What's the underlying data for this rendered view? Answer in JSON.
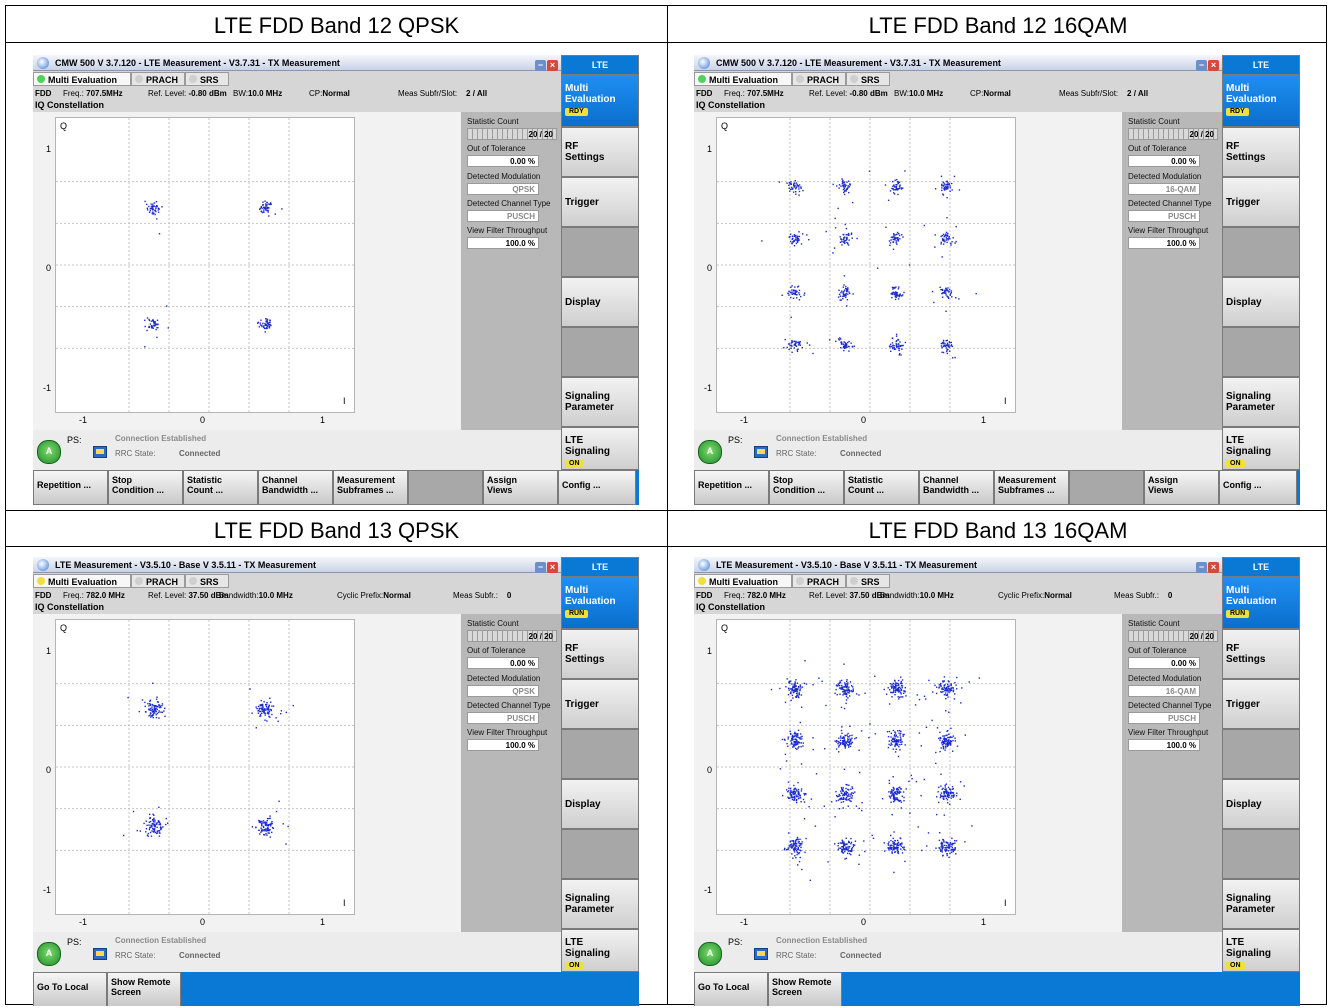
{
  "captions": [
    "LTE FDD Band 12 QPSK",
    "LTE FDD Band 12 16QAM",
    "LTE FDD Band 13 QPSK",
    "LTE FDD Band 13 16QAM"
  ],
  "panels": [
    {
      "title": "CMW 500 V 3.7.120 - LTE Measurement  - V3.7.31 - TX Measurement",
      "tabs": [
        "Multi Evaluation",
        "PRACH",
        "SRS"
      ],
      "led": "green",
      "info": {
        "mode": "FDD",
        "freq_label": "Freq.:",
        "freq": "707.5MHz",
        "ref_label": "Ref. Level:",
        "ref": "-0.80 dBm",
        "bw_label": "BW:",
        "bw": "10.0 MHz",
        "cp_label": "CP:",
        "cp": "Normal",
        "subfr_label": "Meas Subfr/Slot:",
        "subfr": "2  / All"
      },
      "plot_title": "IQ Constellation",
      "axis": {
        "q": "Q",
        "i": "I",
        "y_ticks": [
          "1",
          "0",
          "-1"
        ],
        "x_ticks": [
          "-1",
          "0",
          "1"
        ]
      },
      "stats": {
        "count_label": "Statistic Count",
        "count": "20 / 20",
        "tol_label": "Out of Tolerance",
        "tol": "0.00  %",
        "mod_label": "Detected Modulation",
        "mod": "QPSK",
        "chan_label": "Detected Channel Type",
        "chan": "PUSCH",
        "thr_label": "View Filter Throughput",
        "thr": "100.0  %"
      },
      "status": {
        "ps": "PS:",
        "conn": "Connection Established",
        "rrc_label": "RRC State:",
        "rrc": "Connected",
        "antenna": "A"
      },
      "softkeys": [
        "Repetition ...",
        "Stop\nCondition ...",
        "Statistic\nCount ...",
        "Channel\nBandwidth ...",
        "Measurement\nSubframes ...",
        "",
        "Assign\nViews",
        "Config ..."
      ],
      "sidebar": {
        "top": "LTE",
        "multi": "Multi\nEvaluation",
        "multi_badge": "RDY",
        "rf": "RF\nSettings",
        "trigger": "Trigger",
        "display": "Display",
        "signaling_param": "Signaling\nParameter",
        "lte_sig": "LTE\nSignaling",
        "lte_sig_badge": "ON"
      },
      "constellation": {
        "modulation": "QPSK",
        "points": [
          [
            -0.7,
            0.7
          ],
          [
            0.7,
            0.7
          ],
          [
            -0.7,
            -0.7
          ],
          [
            0.7,
            -0.7
          ]
        ]
      }
    },
    {
      "title": "CMW 500 V 3.7.120 - LTE Measurement  - V3.7.31 - TX Measurement",
      "tabs": [
        "Multi Evaluation",
        "PRACH",
        "SRS"
      ],
      "led": "green",
      "info": {
        "mode": "FDD",
        "freq_label": "Freq.:",
        "freq": "707.5MHz",
        "ref_label": "Ref. Level:",
        "ref": "-0.80 dBm",
        "bw_label": "BW:",
        "bw": "10.0 MHz",
        "cp_label": "CP:",
        "cp": "Normal",
        "subfr_label": "Meas Subfr/Slot:",
        "subfr": "2  / All"
      },
      "plot_title": "IQ Constellation",
      "axis": {
        "q": "Q",
        "i": "I",
        "y_ticks": [
          "1",
          "0",
          "-1"
        ],
        "x_ticks": [
          "-1",
          "0",
          "1"
        ]
      },
      "stats": {
        "count_label": "Statistic Count",
        "count": "20 / 20",
        "tol_label": "Out of Tolerance",
        "tol": "0.00  %",
        "mod_label": "Detected Modulation",
        "mod": "16-QAM",
        "chan_label": "Detected Channel Type",
        "chan": "PUSCH",
        "thr_label": "View Filter Throughput",
        "thr": "100.0  %"
      },
      "status": {
        "ps": "PS:",
        "conn": "Connection Established",
        "rrc_label": "RRC State:",
        "rrc": "Connected",
        "antenna": "A"
      },
      "softkeys": [
        "Repetition ...",
        "Stop\nCondition ...",
        "Statistic\nCount ...",
        "Channel\nBandwidth ...",
        "Measurement\nSubframes ...",
        "",
        "Assign\nViews",
        "Config ..."
      ],
      "sidebar": {
        "top": "LTE",
        "multi": "Multi\nEvaluation",
        "multi_badge": "RDY",
        "rf": "RF\nSettings",
        "trigger": "Trigger",
        "display": "Display",
        "signaling_param": "Signaling\nParameter",
        "lte_sig": "LTE\nSignaling",
        "lte_sig_badge": "ON"
      },
      "constellation": {
        "modulation": "16QAM",
        "points": [
          [
            -0.95,
            0.95
          ],
          [
            -0.32,
            0.95
          ],
          [
            0.32,
            0.95
          ],
          [
            0.95,
            0.95
          ],
          [
            -0.95,
            0.32
          ],
          [
            -0.32,
            0.32
          ],
          [
            0.32,
            0.32
          ],
          [
            0.95,
            0.32
          ],
          [
            -0.95,
            -0.32
          ],
          [
            -0.32,
            -0.32
          ],
          [
            0.32,
            -0.32
          ],
          [
            0.95,
            -0.32
          ],
          [
            -0.95,
            -0.95
          ],
          [
            -0.32,
            -0.95
          ],
          [
            0.32,
            -0.95
          ],
          [
            0.95,
            -0.95
          ]
        ]
      }
    },
    {
      "title": "LTE Measurement  - V3.5.10 - Base V 3.5.11 - TX Measurement",
      "tabs": [
        "Multi Evaluation",
        "PRACH",
        "SRS"
      ],
      "led": "yellow",
      "info": {
        "mode": "FDD",
        "freq_label": "Freq.:",
        "freq": "782.0 MHz",
        "ref_label": "Ref. Level:",
        "ref": "37.50 dBm",
        "bw_label": "Bandwidth:",
        "bw": "10.0 MHz",
        "cp_label": "Cyclic Prefix:",
        "cp": "Normal",
        "subfr_label": "Meas Subfr.:",
        "subfr": "0"
      },
      "plot_title": "IQ Constellation",
      "axis": {
        "q": "Q",
        "i": "I",
        "y_ticks": [
          "1",
          "0",
          "-1"
        ],
        "x_ticks": [
          "-1",
          "0",
          "1"
        ]
      },
      "stats": {
        "count_label": "Statistic Count",
        "count": "20 / 20",
        "tol_label": "Out of Tolerance",
        "tol": "0.00  %",
        "mod_label": "Detected Modulation",
        "mod": "QPSK",
        "chan_label": "Detected Channel Type",
        "chan": "PUSCH",
        "thr_label": "View Filter Throughput",
        "thr": "100.0  %"
      },
      "status": {
        "ps": "PS:",
        "conn": "Connection Established",
        "rrc_label": "RRC State:",
        "rrc": "Connected",
        "antenna": "A"
      },
      "softkeys": [
        "Go To Local",
        "Show Remote\nScreen"
      ],
      "sidebar": {
        "top": "LTE",
        "multi": "Multi\nEvaluation",
        "multi_badge": "RUN",
        "rf": "RF\nSettings",
        "trigger": "Trigger",
        "display": "Display",
        "signaling_param": "Signaling\nParameter",
        "lte_sig": "LTE\nSignaling",
        "lte_sig_badge": "ON"
      },
      "constellation": {
        "modulation": "QPSK",
        "points": [
          [
            -0.7,
            0.7
          ],
          [
            0.7,
            0.7
          ],
          [
            -0.7,
            -0.7
          ],
          [
            0.7,
            -0.7
          ]
        ]
      }
    },
    {
      "title": "LTE Measurement  - V3.5.10 - Base V 3.5.11 - TX Measurement",
      "tabs": [
        "Multi Evaluation",
        "PRACH",
        "SRS"
      ],
      "led": "yellow",
      "info": {
        "mode": "FDD",
        "freq_label": "Freq.:",
        "freq": "782.0 MHz",
        "ref_label": "Ref. Level:",
        "ref": "37.50 dBm",
        "bw_label": "Bandwidth:",
        "bw": "10.0 MHz",
        "cp_label": "Cyclic Prefix:",
        "cp": "Normal",
        "subfr_label": "Meas Subfr.:",
        "subfr": "0"
      },
      "plot_title": "IQ Constellation",
      "axis": {
        "q": "Q",
        "i": "I",
        "y_ticks": [
          "1",
          "0",
          "-1"
        ],
        "x_ticks": [
          "-1",
          "0",
          "1"
        ]
      },
      "stats": {
        "count_label": "Statistic Count",
        "count": "20 / 20",
        "tol_label": "Out of Tolerance",
        "tol": "0.00  %",
        "mod_label": "Detected Modulation",
        "mod": "16-QAM",
        "chan_label": "Detected Channel Type",
        "chan": "PUSCH",
        "thr_label": "View Filter Throughput",
        "thr": "100.0  %"
      },
      "status": {
        "ps": "PS:",
        "conn": "Connection Established",
        "rrc_label": "RRC State:",
        "rrc": "Connected",
        "antenna": "A"
      },
      "softkeys": [
        "Go To Local",
        "Show Remote\nScreen"
      ],
      "sidebar": {
        "top": "LTE",
        "multi": "Multi\nEvaluation",
        "multi_badge": "RUN",
        "rf": "RF\nSettings",
        "trigger": "Trigger",
        "display": "Display",
        "signaling_param": "Signaling\nParameter",
        "lte_sig": "LTE\nSignaling",
        "lte_sig_badge": "ON"
      },
      "constellation": {
        "modulation": "16QAM",
        "points": [
          [
            -0.95,
            0.95
          ],
          [
            -0.32,
            0.95
          ],
          [
            0.32,
            0.95
          ],
          [
            0.95,
            0.95
          ],
          [
            -0.95,
            0.32
          ],
          [
            -0.32,
            0.32
          ],
          [
            0.32,
            0.32
          ],
          [
            0.95,
            0.32
          ],
          [
            -0.95,
            -0.32
          ],
          [
            -0.32,
            -0.32
          ],
          [
            0.32,
            -0.32
          ],
          [
            0.95,
            -0.32
          ],
          [
            -0.95,
            -0.95
          ],
          [
            -0.32,
            -0.95
          ],
          [
            0.32,
            -0.95
          ],
          [
            0.95,
            -0.95
          ]
        ]
      }
    }
  ],
  "colors": {
    "accent_blue": "#0a79d6",
    "scatter_point": "#1a2ad0",
    "led_green": "#4fd25a",
    "led_yellow": "#f0df3a",
    "badge_yellow": "#f0e13a"
  }
}
